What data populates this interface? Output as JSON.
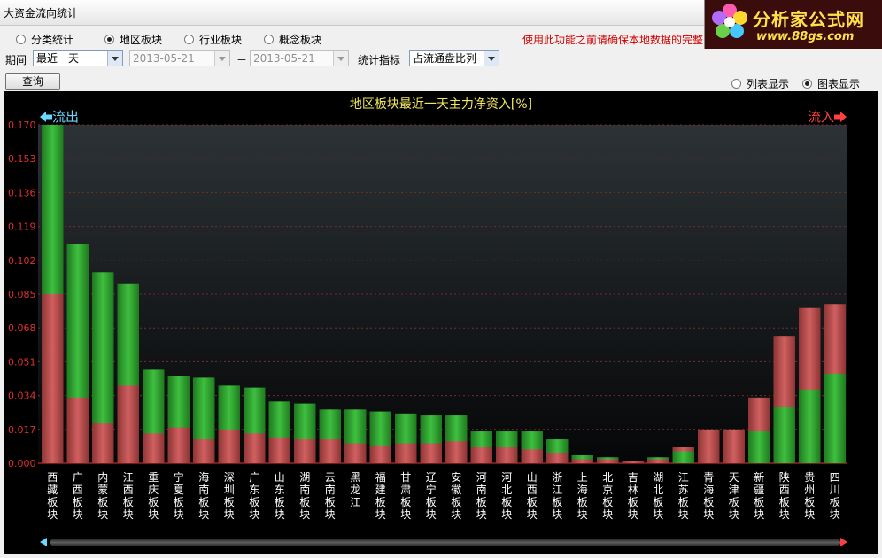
{
  "window": {
    "title": "大资金流向统计"
  },
  "logo": {
    "name": "分析家公式网",
    "url": "www.88gs.com"
  },
  "classify": {
    "options": [
      {
        "label": "分类统计",
        "selected": false
      },
      {
        "label": "地区板块",
        "selected": true
      },
      {
        "label": "行业板块",
        "selected": false
      },
      {
        "label": "概念板块",
        "selected": false
      }
    ]
  },
  "filters": {
    "period_label": "期间",
    "period_value": "最近一天",
    "date_from": "2013-05-21",
    "date_sep": "－",
    "date_to": "2013-05-21",
    "metric_label": "统计指标",
    "metric_value": "占流通盘比列",
    "query_button": "查询"
  },
  "notice": "使用此功能之前请确保本地数据的完整",
  "display": {
    "list_label": "列表显示",
    "list_selected": false,
    "chart_label": "图表显示",
    "chart_selected": true
  },
  "colors": {
    "green": "#2ea12e",
    "red": "#c05050",
    "outflow": "#6ad8ff",
    "inflow": "#ff4040"
  },
  "chart_data": {
    "type": "bar",
    "title": "地区板块最近一天主力净资入[%]",
    "left_label": "流出",
    "right_label": "流入",
    "ylim": [
      0,
      0.17
    ],
    "yticks": [
      "0.170",
      "0.153",
      "0.136",
      "0.119",
      "0.102",
      "0.085",
      "0.068",
      "0.051",
      "0.034",
      "0.017",
      "0.000"
    ],
    "grid": true,
    "categories": [
      "西藏板块",
      "广西板块",
      "内蒙板块",
      "江西板块",
      "重庆板块",
      "宁夏板块",
      "海南板块",
      "深圳板块",
      "广东板块",
      "山东板块",
      "湖南板块",
      "云南板块",
      "黑龙江",
      "福建板块",
      "甘肃板块",
      "辽宁板块",
      "安徽板块",
      "河南板块",
      "河北板块",
      "山西板块",
      "浙江板块",
      "上海板块",
      "北京板块",
      "吉林板块",
      "湖北板块",
      "江苏板块",
      "青海板块",
      "天津板块",
      "新疆板块",
      "陕西板块",
      "贵州板块",
      "四川板块"
    ],
    "series": [
      {
        "color": "green",
        "values": [
          0.17,
          0.11,
          0.096,
          0.09,
          0.047,
          0.044,
          0.043,
          0.039,
          0.038,
          0.031,
          0.03,
          0.027,
          0.027,
          0.026,
          0.025,
          0.024,
          0.024,
          0.016,
          0.016,
          0.016,
          0.012,
          0.004,
          0.003,
          0.001,
          0.003,
          0.006,
          0.0,
          0.0,
          0.016,
          0.028,
          0.037,
          0.045
        ]
      },
      {
        "color": "red",
        "values": [
          0.085,
          0.033,
          0.02,
          0.039,
          0.015,
          0.018,
          0.012,
          0.017,
          0.015,
          0.013,
          0.012,
          0.012,
          0.01,
          0.009,
          0.01,
          0.01,
          0.011,
          0.008,
          0.008,
          0.007,
          0.005,
          0.002,
          0.002,
          0.001,
          0.002,
          0.008,
          0.017,
          0.017,
          0.033,
          0.064,
          0.078,
          0.08
        ]
      }
    ],
    "sides": [
      "out",
      "out",
      "out",
      "out",
      "out",
      "out",
      "out",
      "out",
      "out",
      "out",
      "out",
      "out",
      "out",
      "out",
      "out",
      "out",
      "out",
      "out",
      "out",
      "out",
      "out",
      "out",
      "out",
      "out",
      "out",
      "in",
      "in",
      "in",
      "in",
      "in",
      "in",
      "in"
    ]
  }
}
